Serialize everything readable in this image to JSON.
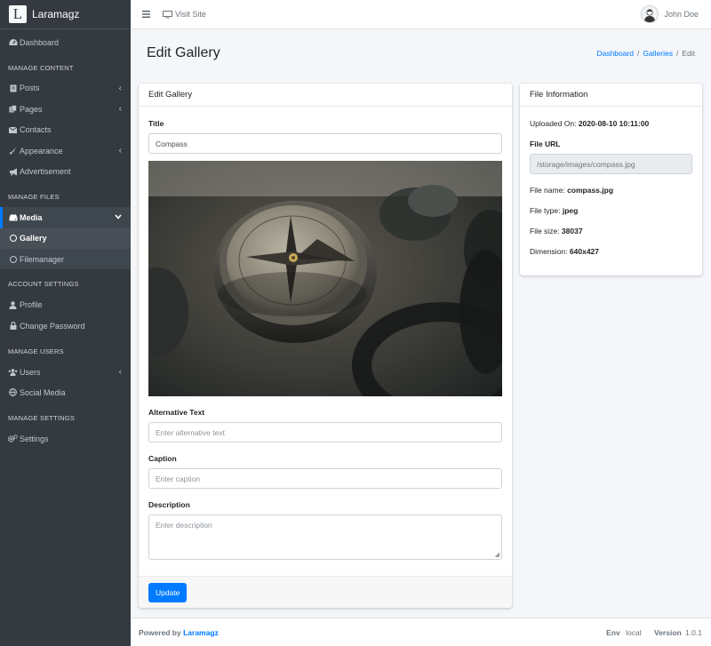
{
  "brand": {
    "logo_letter": "L",
    "name": "Laramagz"
  },
  "topbar": {
    "menu_icon": "hamburger-icon",
    "visit_label": "Visit Site",
    "user_name": "John Doe"
  },
  "sidebar": {
    "dashboard": "Dashboard",
    "headers": {
      "content": "MANAGE CONTENT",
      "files": "MANAGE FILES",
      "account": "ACCOUNT SETTINGS",
      "users": "MANAGE USERS",
      "settings": "MANAGE SETTINGS"
    },
    "content_items": [
      {
        "label": "Posts",
        "icon": "file-icon"
      },
      {
        "label": "Pages",
        "icon": "copy-icon"
      },
      {
        "label": "Contacts",
        "icon": "envelope-icon"
      },
      {
        "label": "Appearance",
        "icon": "paint-brush-icon"
      },
      {
        "label": "Advertisement",
        "icon": "bullhorn-icon"
      }
    ],
    "media": "Media",
    "gallery": "Gallery",
    "filemanager": "Filemanager",
    "profile": "Profile",
    "change_password": "Change Password",
    "users": "Users",
    "social_media": "Social Media",
    "settings": "Settings"
  },
  "page": {
    "title": "Edit Gallery",
    "breadcrumb": [
      "Dashboard",
      "Galleries",
      "Edit"
    ]
  },
  "form": {
    "card_title": "Edit Gallery",
    "title_label": "Title",
    "title_value": "Compass",
    "alt_label": "Alternative Text",
    "alt_placeholder": "Enter alternative text",
    "caption_label": "Caption",
    "caption_placeholder": "Enter caption",
    "description_label": "Description",
    "description_placeholder": "Enter description",
    "update_label": "Update"
  },
  "file_info": {
    "card_title": "File Information",
    "uploaded_label": "Uploaded On:",
    "uploaded_value": "2020-08-10 10:11:00",
    "url_label": "File URL",
    "url_value": "/storage/images/compass.jpg",
    "name_label": "File name:",
    "name_value": "compass.jpg",
    "type_label": "File type:",
    "type_value": "jpeg",
    "size_label": "File size:",
    "size_value": "38037",
    "dimension_label": "Dimension:",
    "dimension_value": "640x427"
  },
  "footer": {
    "powered_by": "Powered by",
    "brand": "Laramagz",
    "env_label": "Env",
    "env_value": "local",
    "version_label": "Version",
    "version_value": "1.0.1"
  }
}
